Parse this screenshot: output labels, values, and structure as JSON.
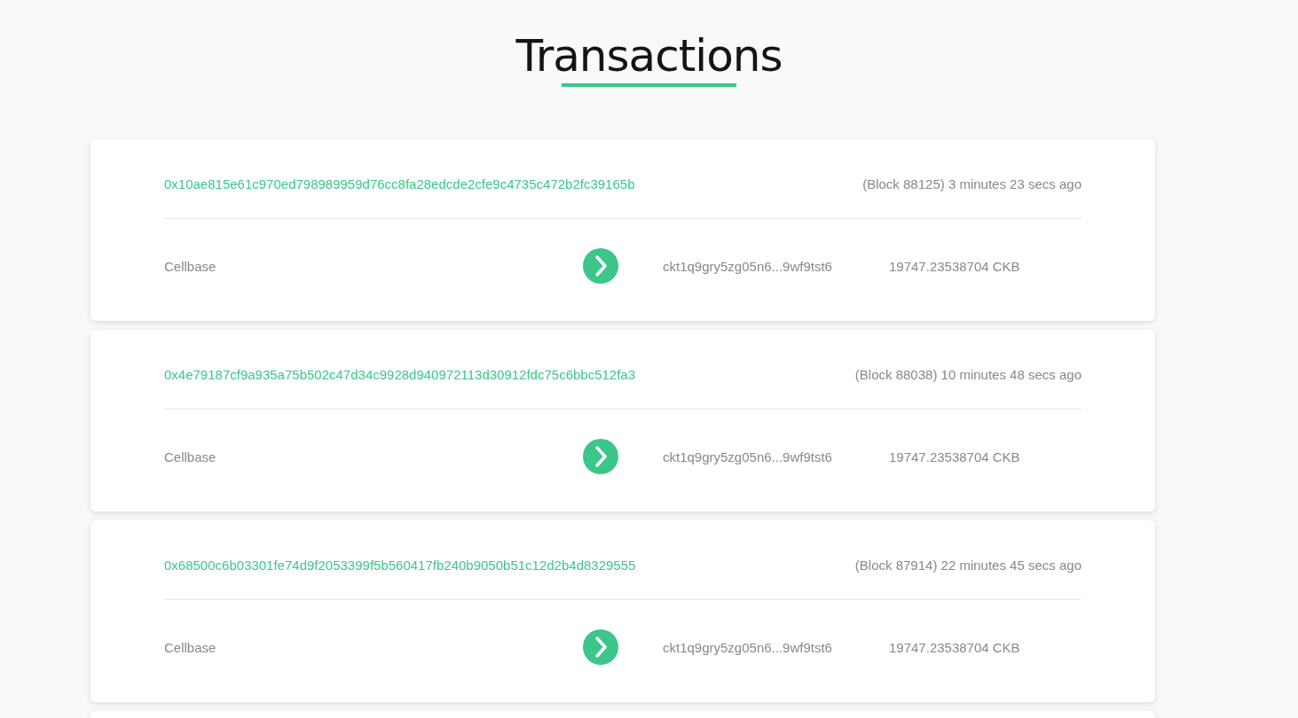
{
  "title": "Transactions",
  "transactions": [
    {
      "hash": "0x10ae815e61c970ed798989959d76cc8fa28edcde2cfe9c4735c472b2fc39165b",
      "block_time": "(Block 88125) 3 minutes 23 secs ago",
      "input": "Cellbase",
      "output_address": "ckt1q9gry5zg05n6...9wf9tst6",
      "amount": "19747.23538704 CKB"
    },
    {
      "hash": "0x4e79187cf9a935a75b502c47d34c9928d940972113d30912fdc75c6bbc512fa3",
      "block_time": "(Block 88038) 10 minutes 48 secs ago",
      "input": "Cellbase",
      "output_address": "ckt1q9gry5zg05n6...9wf9tst6",
      "amount": "19747.23538704 CKB"
    },
    {
      "hash": "0x68500c6b03301fe74d9f2053399f5b560417fb240b9050b51c12d2b4d8329555",
      "block_time": "(Block 87914) 22 minutes 45 secs ago",
      "input": "Cellbase",
      "output_address": "ckt1q9gry5zg05n6...9wf9tst6",
      "amount": "19747.23538704 CKB"
    }
  ]
}
